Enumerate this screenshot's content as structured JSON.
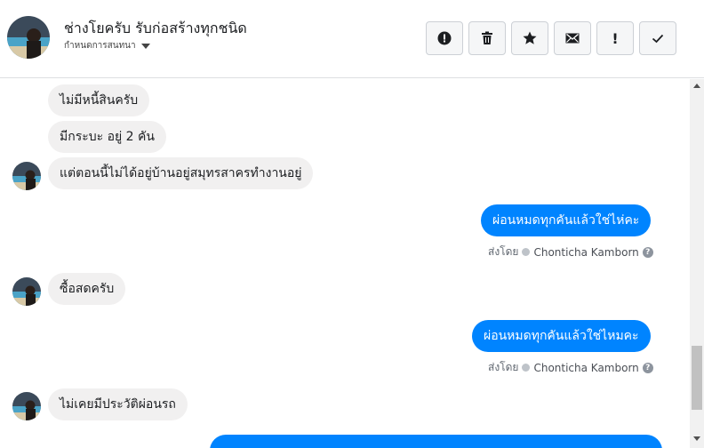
{
  "header": {
    "title": "ช่างโยครับ รับก่อสร้างทุกชนิด",
    "subtitle": "กำหนดการสนทนา",
    "actions": [
      {
        "name": "report-icon"
      },
      {
        "name": "trash-icon"
      },
      {
        "name": "star-icon"
      },
      {
        "name": "envelope-icon"
      },
      {
        "name": "exclamation-icon",
        "glyph": "!"
      },
      {
        "name": "checkmark-icon"
      }
    ]
  },
  "messages": {
    "m1": "ไม่มีหนี้สินครับ",
    "m2": "มีกระบะ อยู่ 2 คัน",
    "m3": "แต่ตอนนี้ไม่ได้อยู่บ้านอยู่สมุทรสาครทำงานอยู่",
    "m4": "ผ่อนหมดทุกคันแล้วใช่ไห่คะ",
    "m4_sent_label": "ส่งโดย",
    "m4_sender": "Chonticha Kamborn",
    "m5": "ซื้อสดครับ",
    "m6": "ผ่อนหมดทุกคันแล้วใช่ไหมคะ",
    "m6_sent_label": "ส่งโดย",
    "m6_sender": "Chonticha Kamborn",
    "m7": "ไม่เคยมีประวัติผ่อนรถ"
  },
  "colors": {
    "outgoing_bubble": "#0084ff",
    "incoming_bubble": "#f1f0f0"
  }
}
